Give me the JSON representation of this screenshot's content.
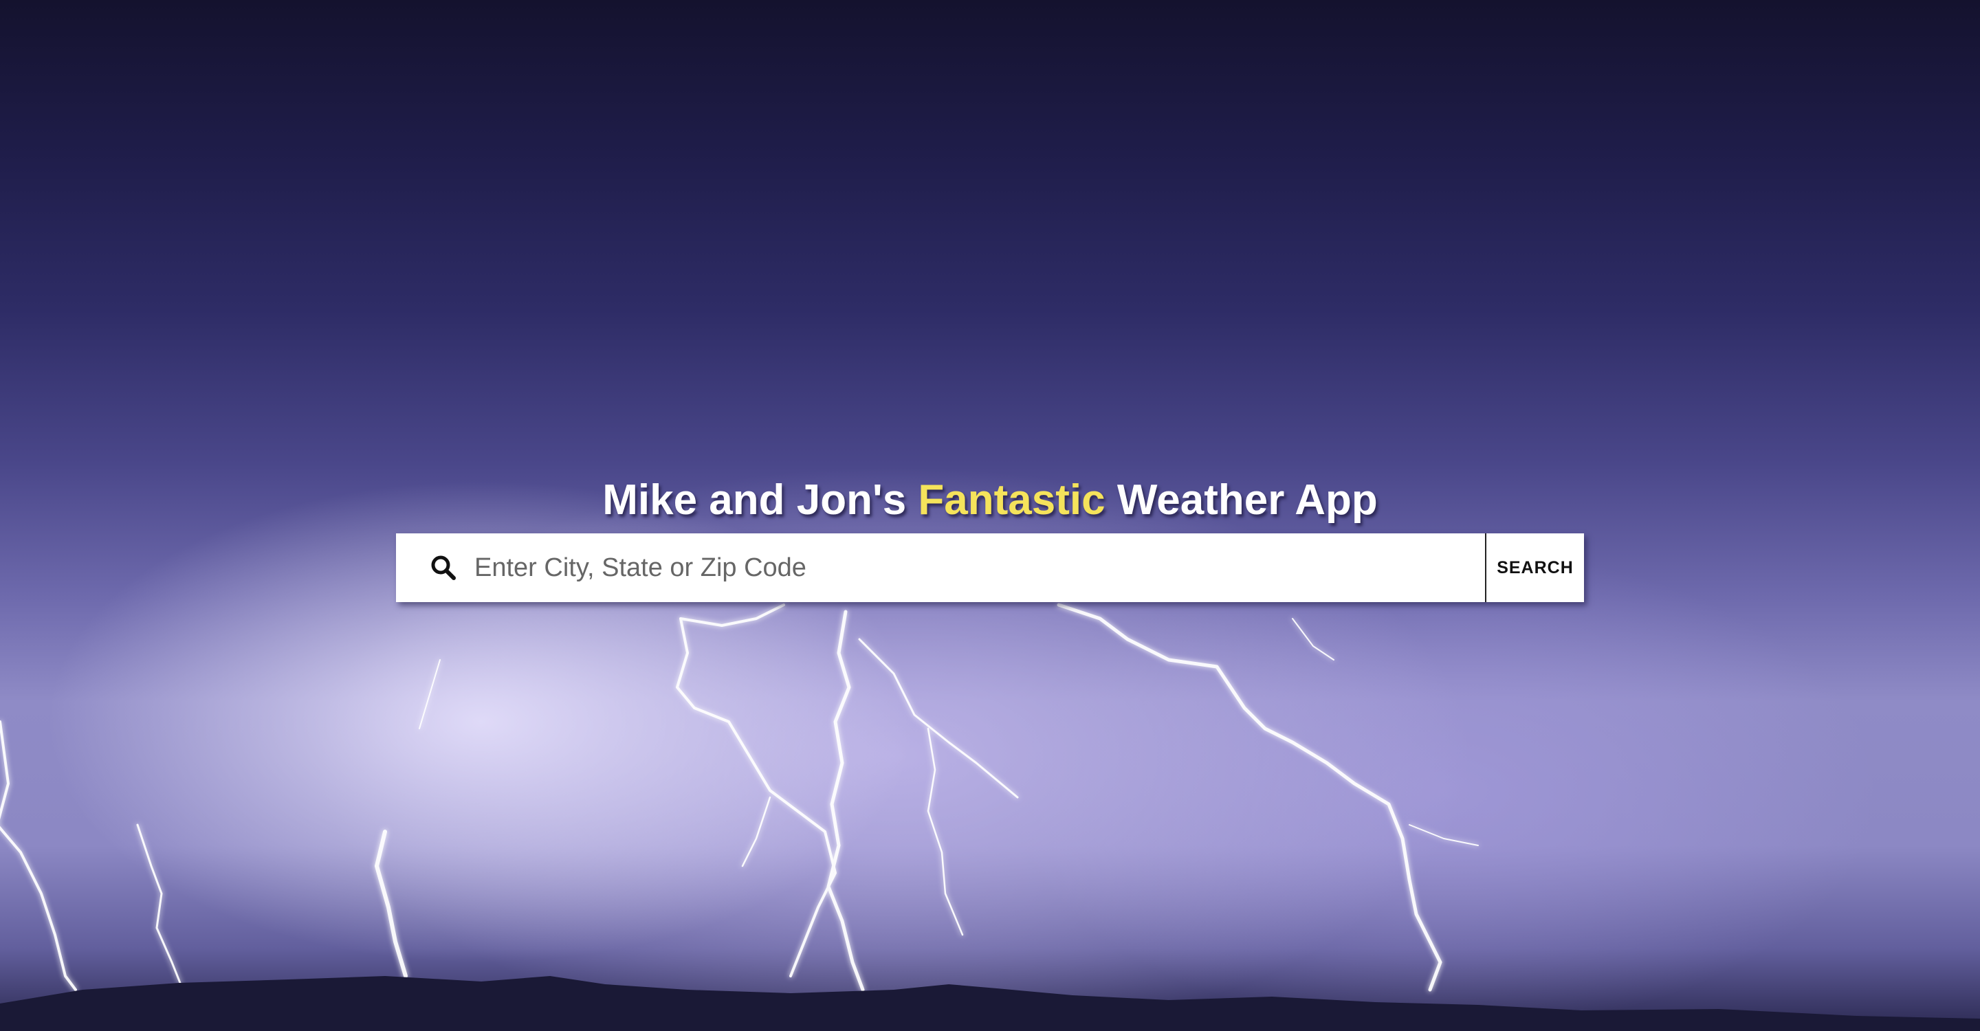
{
  "header": {
    "title_prefix": "Mike and Jon's ",
    "title_highlight": "Fantastic",
    "title_suffix": " Weather App"
  },
  "search": {
    "icon": "search-icon",
    "placeholder": "Enter City, State or Zip Code",
    "value": "",
    "button_label": "SEARCH"
  },
  "colors": {
    "accent": "#f5e35b",
    "title": "#ffffff"
  }
}
